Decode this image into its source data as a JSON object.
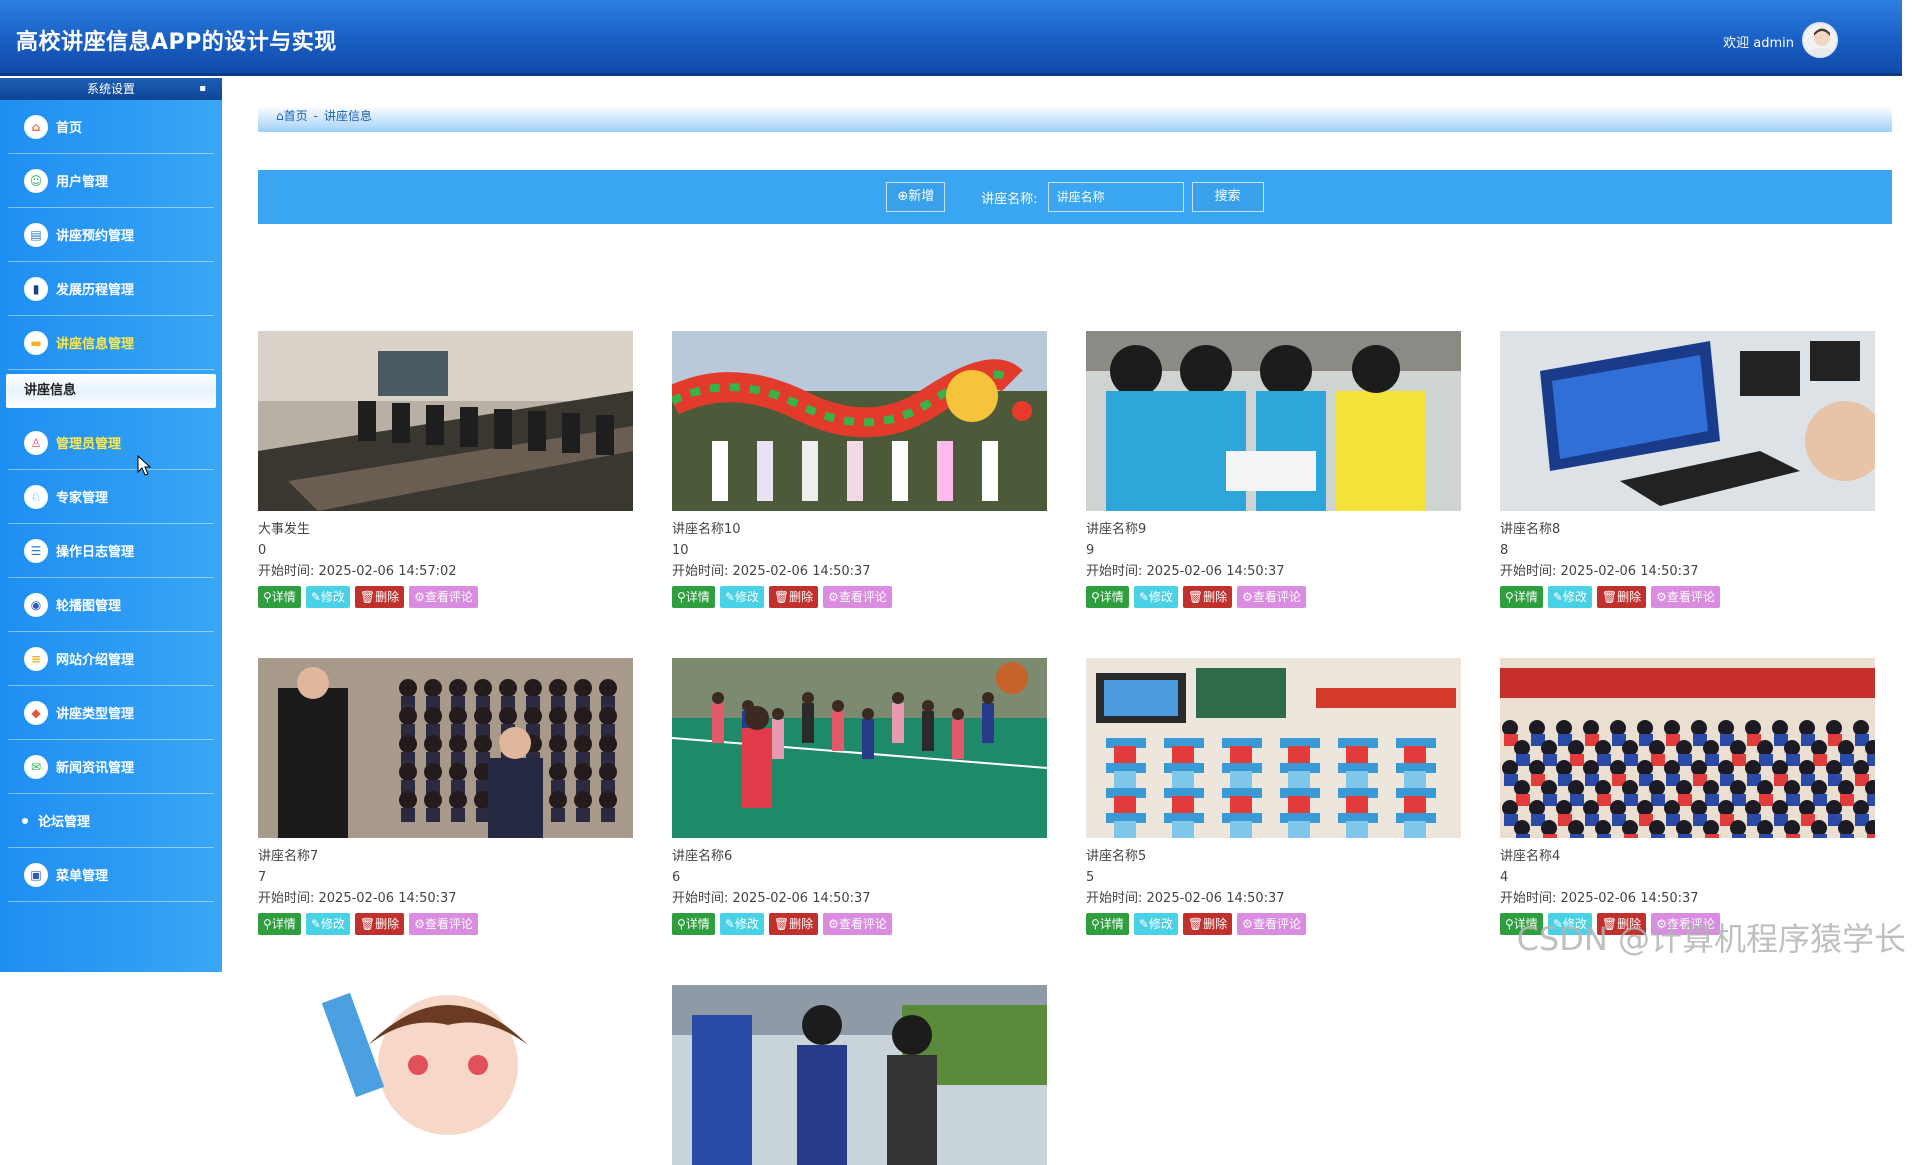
{
  "header": {
    "title": "高校讲座信息APP的设计与实现",
    "welcome": "欢迎 admin"
  },
  "sidebar": {
    "section_title": "系统设置",
    "items": [
      {
        "label": "首页",
        "icon": "home-icon"
      },
      {
        "label": "用户管理",
        "icon": "user-icon"
      },
      {
        "label": "讲座预约管理",
        "icon": "calendar-icon"
      },
      {
        "label": "发展历程管理",
        "icon": "bookmark-icon"
      },
      {
        "label": "讲座信息管理",
        "icon": "briefcase-icon",
        "active": true
      },
      {
        "label": "管理员管理",
        "icon": "admin-icon",
        "active": true
      },
      {
        "label": "专家管理",
        "icon": "expert-icon"
      },
      {
        "label": "操作日志管理",
        "icon": "log-icon"
      },
      {
        "label": "轮播图管理",
        "icon": "carousel-icon"
      },
      {
        "label": "网站介绍管理",
        "icon": "info-icon"
      },
      {
        "label": "讲座类型管理",
        "icon": "type-icon"
      },
      {
        "label": "新闻资讯管理",
        "icon": "news-icon"
      },
      {
        "label": "论坛管理",
        "icon": "bullet"
      },
      {
        "label": "菜单管理",
        "icon": "menu-icon"
      }
    ],
    "sub_item": "讲座信息"
  },
  "breadcrumb": {
    "home": "首页",
    "sep": "-",
    "current": "讲座信息"
  },
  "toolbar": {
    "add_label": "⊕新增",
    "search_label": "讲座名称:",
    "search_placeholder": "讲座名称",
    "search_button": "搜索"
  },
  "actions": {
    "detail": "详情",
    "edit": "修改",
    "delete": "删除",
    "review": "查看评论"
  },
  "cards": [
    {
      "name": "大事发生",
      "num": "0",
      "time": "开始时间: 2025-02-06 14:57:02",
      "theme": "meeting-room"
    },
    {
      "name": "讲座名称10",
      "num": "10",
      "time": "开始时间: 2025-02-06 14:50:37",
      "theme": "dragon-parade"
    },
    {
      "name": "讲座名称9",
      "num": "9",
      "time": "开始时间: 2025-02-06 14:50:37",
      "theme": "students-reading"
    },
    {
      "name": "讲座名称8",
      "num": "8",
      "time": "开始时间: 2025-02-06 14:50:37",
      "theme": "computer-lab"
    },
    {
      "name": "讲座名称7",
      "num": "7",
      "time": "开始时间: 2025-02-06 14:50:37",
      "theme": "auditorium"
    },
    {
      "name": "讲座名称6",
      "num": "6",
      "time": "开始时间: 2025-02-06 14:50:37",
      "theme": "basketball"
    },
    {
      "name": "讲座名称5",
      "num": "5",
      "time": "开始时间: 2025-02-06 14:50:37",
      "theme": "classroom"
    },
    {
      "name": "讲座名称4",
      "num": "4",
      "time": "开始时间: 2025-02-06 14:50:37",
      "theme": "assembly"
    },
    {
      "name": "",
      "num": "",
      "time": "",
      "theme": "cartoon"
    },
    {
      "name": "",
      "num": "",
      "time": "",
      "theme": "outdoor"
    }
  ],
  "watermark": "CSDN @计算机程序猿学长"
}
